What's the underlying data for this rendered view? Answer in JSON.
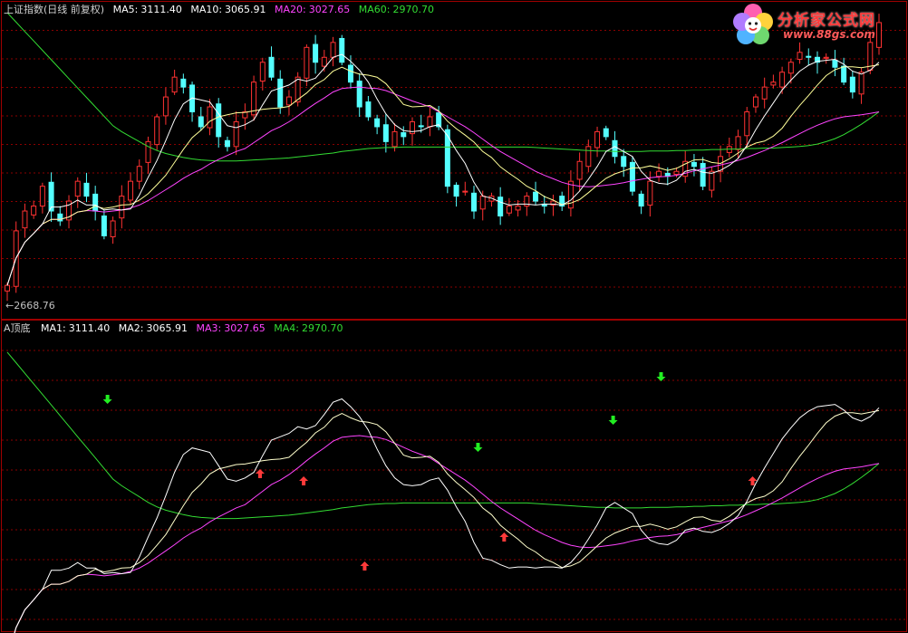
{
  "main_panel": {
    "title": "上证指数(日线 前复权)",
    "legend": [
      {
        "key": "ma5",
        "label": "MA5:",
        "value": "3111.40",
        "color": "#ffffff"
      },
      {
        "key": "ma10",
        "label": "MA10:",
        "value": "3065.91",
        "color": "#ffff66"
      },
      {
        "key": "ma20",
        "label": "MA20:",
        "value": "3027.65",
        "color": "#ff44ff"
      },
      {
        "key": "ma60",
        "label": "MA60:",
        "value": "2970.70",
        "color": "#33dd33"
      }
    ],
    "low_marker": "←2668.76"
  },
  "indicator_panel": {
    "title": "A顶底",
    "legend": [
      {
        "key": "ma1",
        "label": "MA1:",
        "value": "3111.40",
        "color": "#ffffff"
      },
      {
        "key": "ma2",
        "label": "MA2:",
        "value": "3065.91",
        "color": "#ffff66"
      },
      {
        "key": "ma3",
        "label": "MA3:",
        "value": "3027.65",
        "color": "#ff44ff"
      },
      {
        "key": "ma4",
        "label": "MA4:",
        "value": "2970.70",
        "color": "#33dd33"
      }
    ]
  },
  "logo": {
    "title": "分析家公式网",
    "url": "www.88gs.com"
  },
  "colors": {
    "up": "#ff3232",
    "down": "#54ffff",
    "grid": "#8a0000",
    "border": "#a00000"
  },
  "chart_data": {
    "type": "candlestick",
    "count": 100,
    "ylim": [
      2640,
      3250
    ],
    "low_value": 2668.76,
    "closes": [
      2700,
      2810,
      2850,
      2860,
      2900,
      2850,
      2830,
      2870,
      2910,
      2880,
      2850,
      2800,
      2830,
      2880,
      2910,
      2940,
      2990,
      3040,
      3080,
      3120,
      3100,
      3050,
      3020,
      3060,
      3000,
      2980,
      3030,
      3050,
      3110,
      3150,
      3120,
      3060,
      3080,
      3120,
      3180,
      3150,
      3160,
      3190,
      3150,
      3110,
      3060,
      3040,
      3020,
      2990,
      3010,
      3000,
      3030,
      3020,
      3040,
      3020,
      2900,
      2880,
      2890,
      2850,
      2880,
      2880,
      2840,
      2860,
      2860,
      2880,
      2870,
      2860,
      2870,
      2860,
      2910,
      2950,
      2980,
      3010,
      3000,
      2960,
      2940,
      2890,
      2860,
      2910,
      2930,
      2920,
      2930,
      2950,
      2940,
      2900,
      2930,
      2960,
      2980,
      3000,
      3050,
      3080,
      3100,
      3110,
      3130,
      3150,
      3170,
      3160,
      3150,
      3160,
      3140,
      3110,
      3090,
      3130,
      3190,
      3230
    ],
    "ma5": [
      2700,
      2755,
      2787,
      2805,
      2824,
      2858,
      2858,
      2862,
      2872,
      2862,
      2862,
      2852,
      2854,
      2852,
      2854,
      2882,
      2918,
      2952,
      2992,
      3034,
      3066,
      3078,
      3074,
      3070,
      3046,
      3022,
      3018,
      3024,
      3034,
      3064,
      3092,
      3098,
      3104,
      3116,
      3112,
      3118,
      3138,
      3160,
      3166,
      3152,
      3134,
      3110,
      3076,
      3046,
      3024,
      3012,
      3010,
      3012,
      3020,
      3024,
      3002,
      2972,
      2946,
      2908,
      2880,
      2876,
      2868,
      2862,
      2864,
      2864,
      2862,
      2864,
      2864,
      2862,
      2872,
      2890,
      2914,
      2940,
      2970,
      2980,
      2970,
      2960,
      2930,
      2912,
      2906,
      2904,
      2912,
      2930,
      2934,
      2928,
      2926,
      2932,
      2942,
      2956,
      2982,
      3014,
      3042,
      3068,
      3094,
      3114,
      3132,
      3144,
      3152,
      3154,
      3156,
      3146,
      3132,
      3126,
      3134,
      3150
    ],
    "ma10": [
      2700,
      2755,
      2787,
      2805,
      2824,
      2833,
      2833,
      2838,
      2848,
      2851,
      2860,
      2855,
      2858,
      2862,
      2863,
      2872,
      2885,
      2903,
      2922,
      2948,
      2974,
      2998,
      3013,
      3031,
      3040,
      3044,
      3048,
      3049,
      3052,
      3055,
      3057,
      3058,
      3061,
      3075,
      3088,
      3105,
      3115,
      3132,
      3140,
      3132,
      3126,
      3124,
      3120,
      3107,
      3086,
      3065,
      3060,
      3061,
      3063,
      3052,
      3031,
      3016,
      3003,
      2989,
      2970,
      2958,
      2939,
      2926,
      2914,
      2900,
      2891,
      2879,
      2872,
      2863,
      2866,
      2873,
      2887,
      2902,
      2916,
      2925,
      2931,
      2937,
      2937,
      2941,
      2937,
      2932,
      2936,
      2945,
      2953,
      2954,
      2948,
      2946,
      2955,
      2967,
      2979,
      2987,
      2991,
      3001,
      3017,
      3041,
      3063,
      3083,
      3104,
      3123,
      3135,
      3141,
      3141,
      3139,
      3142,
      3145
    ],
    "ma20": [
      2700,
      2755,
      2787,
      2805,
      2824,
      2833,
      2833,
      2838,
      2848,
      2851,
      2850,
      2848,
      2850,
      2852,
      2856,
      2862,
      2871,
      2882,
      2893,
      2904,
      2916,
      2926,
      2934,
      2945,
      2954,
      2962,
      2970,
      2976,
      2988,
      3000,
      3012,
      3020,
      3030,
      3042,
      3055,
      3067,
      3078,
      3090,
      3097,
      3099,
      3100,
      3098,
      3097,
      3093,
      3086,
      3079,
      3072,
      3066,
      3060,
      3050,
      3040,
      3030,
      3020,
      3008,
      2995,
      2982,
      2970,
      2960,
      2950,
      2940,
      2930,
      2922,
      2915,
      2908,
      2903,
      2900,
      2899,
      2900,
      2902,
      2904,
      2907,
      2911,
      2914,
      2917,
      2919,
      2920,
      2922,
      2926,
      2931,
      2935,
      2939,
      2943,
      2947,
      2952,
      2958,
      2965,
      2972,
      2980,
      2988,
      2997,
      3006,
      3015,
      3023,
      3030,
      3036,
      3040,
      3042,
      3044,
      3047,
      3050
    ],
    "ma60": [
      3250,
      3231,
      3212,
      3193,
      3174,
      3155,
      3136,
      3117,
      3098,
      3079,
      3060,
      3041,
      3022,
      3010,
      3000,
      2990,
      2980,
      2972,
      2966,
      2962,
      2958,
      2955,
      2953,
      2952,
      2951,
      2951,
      2951,
      2952,
      2953,
      2954,
      2955,
      2956,
      2957,
      2959,
      2961,
      2963,
      2965,
      2967,
      2970,
      2972,
      2974,
      2976,
      2977,
      2978,
      2978,
      2979,
      2979,
      2979,
      2979,
      2979,
      2979,
      2979,
      2979,
      2979,
      2979,
      2979,
      2979,
      2979,
      2979,
      2979,
      2978,
      2977,
      2976,
      2975,
      2974,
      2973,
      2972,
      2971,
      2971,
      2970,
      2970,
      2970,
      2970,
      2971,
      2971,
      2971,
      2972,
      2972,
      2973,
      2973,
      2974,
      2974,
      2975,
      2975,
      2976,
      2976,
      2977,
      2977,
      2978,
      2979,
      2980,
      2982,
      2985,
      2990,
      2996,
      3004,
      3014,
      3025,
      3037,
      3050
    ],
    "up_arrows": [
      58,
      68,
      82,
      114,
      171
    ],
    "down_arrows": [
      23,
      108,
      139,
      150
    ]
  }
}
